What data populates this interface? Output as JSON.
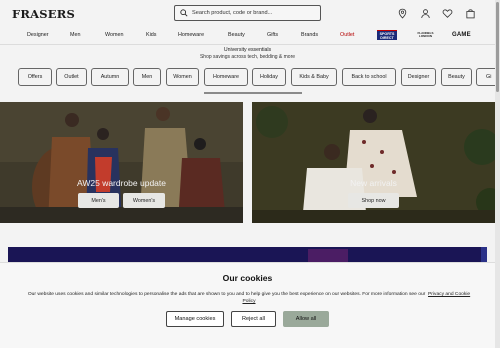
{
  "header": {
    "logo": "FRASERS",
    "search_placeholder": "Search product, code or brand..."
  },
  "nav": {
    "items": [
      "Designer",
      "Men",
      "Women",
      "Kids",
      "Homeware",
      "Beauty",
      "Gifts",
      "Brands",
      "Outlet"
    ],
    "brand_logos": {
      "sports_direct_line1": "SPORTS",
      "sports_direct_line2": "DIRECT",
      "flannels_line1": "FLANNELS",
      "flannels_line2": "LONDON",
      "game": "GAME"
    }
  },
  "promo": {
    "title": "University essentials",
    "subtitle": "Shop savings across tech, bedding & more"
  },
  "categories": [
    "Offers",
    "Outlet",
    "Autumn",
    "Men",
    "Women",
    "Homeware",
    "Holiday",
    "Kids & Baby",
    "Back to school",
    "Designer",
    "Beauty",
    "Gi"
  ],
  "hero_left": {
    "title": "AW25 wardrobe update",
    "buttons": [
      "Men's",
      "Women's"
    ]
  },
  "hero_right": {
    "title": "New arrivals",
    "button": "Shop now"
  },
  "cookie": {
    "title": "Our cookies",
    "text": "Our website uses cookies and similar technologies to personalise the ads that are shown to you and to help give you the best experience on our websites. For more information see our",
    "link": "Privacy and Cookie Policy",
    "buttons": {
      "manage": "Manage cookies",
      "reject": "Reject all",
      "allow": "Allow all"
    }
  },
  "colors": {
    "outlet": "#b40000",
    "allow_button": "#9aa99a",
    "banner": "#1a1555"
  }
}
